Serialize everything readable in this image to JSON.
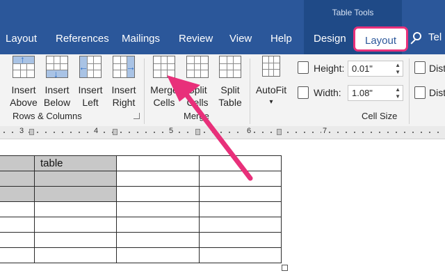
{
  "title_bar": {
    "context_label": "Table Tools"
  },
  "tabs": [
    {
      "label": "Layout"
    },
    {
      "label": "References"
    },
    {
      "label": "Mailings"
    },
    {
      "label": "Review"
    },
    {
      "label": "View"
    },
    {
      "label": "Help"
    },
    {
      "label": "Design"
    },
    {
      "label": "Layout"
    }
  ],
  "tell_me": {
    "label": "Tel",
    "icon": "search-icon"
  },
  "ribbon": {
    "rows_columns": {
      "group_label": "Rows & Columns",
      "buttons": [
        {
          "line1": "Insert",
          "line2": "Above",
          "icon": "insert-above-icon"
        },
        {
          "line1": "Insert",
          "line2": "Below",
          "icon": "insert-below-icon"
        },
        {
          "line1": "Insert",
          "line2": "Left",
          "icon": "insert-left-icon"
        },
        {
          "line1": "Insert",
          "line2": "Right",
          "icon": "insert-right-icon"
        }
      ]
    },
    "merge": {
      "group_label": "Merge",
      "buttons": [
        {
          "line1": "Merge",
          "line2": "Cells",
          "icon": "merge-cells-icon"
        },
        {
          "line1": "Split",
          "line2": "Cells",
          "icon": "split-cells-icon"
        },
        {
          "line1": "Split",
          "line2": "Table",
          "icon": "split-table-icon"
        }
      ]
    },
    "cell_size": {
      "group_label": "Cell Size",
      "autofit": {
        "label": "AutoFit",
        "icon": "autofit-icon"
      },
      "height": {
        "label": "Height:",
        "value": "0.01\""
      },
      "width": {
        "label": "Width:",
        "value": "1.08\""
      },
      "distribute_label": "Dist"
    }
  },
  "ruler": {
    "numbers": [
      "3",
      "4",
      "5",
      "6",
      "7"
    ]
  },
  "document": {
    "table": {
      "rows": [
        [
          "",
          "table",
          "",
          ""
        ],
        [
          "",
          "",
          "",
          ""
        ],
        [
          "",
          "",
          "",
          ""
        ],
        [
          "",
          "",
          "",
          ""
        ],
        [
          "",
          "",
          "",
          ""
        ],
        [
          "",
          "",
          "",
          ""
        ],
        [
          "",
          "",
          "",
          ""
        ]
      ]
    }
  },
  "colors": {
    "ribbon_blue": "#2b579a",
    "highlight_pink": "#e8307a",
    "cell_shade": "#c8c8c8"
  }
}
